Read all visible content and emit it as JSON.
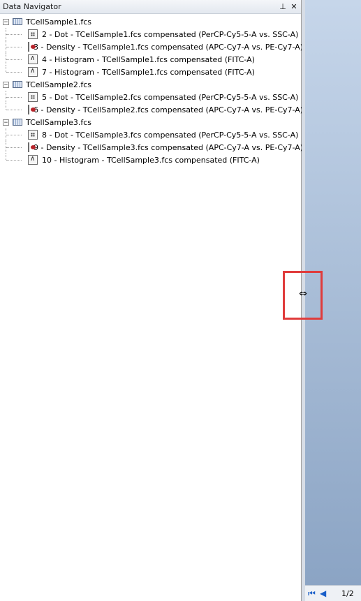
{
  "panel": {
    "title": "Data Navigator",
    "pin_glyph": "⊥",
    "close_glyph": "✕"
  },
  "tree": [
    {
      "file": "TCellSample1.fcs",
      "expander": "−",
      "children": [
        {
          "kind": "dot",
          "label": "2 - Dot - TCellSample1.fcs compensated (PerCP-Cy5-5-A vs. SSC-A)"
        },
        {
          "kind": "density",
          "label": "3 - Density - TCellSample1.fcs compensated (APC-Cy7-A vs. PE-Cy7-A)"
        },
        {
          "kind": "histogram",
          "label": "4 - Histogram - TCellSample1.fcs compensated (FITC-A)"
        },
        {
          "kind": "histogram",
          "label": "7 - Histogram - TCellSample1.fcs compensated (FITC-A)"
        }
      ]
    },
    {
      "file": "TCellSample2.fcs",
      "expander": "−",
      "children": [
        {
          "kind": "dot",
          "label": "5 - Dot - TCellSample2.fcs compensated (PerCP-Cy5-5-A vs. SSC-A)"
        },
        {
          "kind": "density",
          "label": "6 - Density - TCellSample2.fcs compensated (APC-Cy7-A vs. PE-Cy7-A)"
        }
      ]
    },
    {
      "file": "TCellSample3.fcs",
      "expander": "−",
      "children": [
        {
          "kind": "dot",
          "label": "8 - Dot - TCellSample3.fcs compensated (PerCP-Cy5-5-A vs. SSC-A)"
        },
        {
          "kind": "density",
          "label": "9 - Density - TCellSample3.fcs compensated (APC-Cy7-A vs. PE-Cy7-A)"
        },
        {
          "kind": "histogram",
          "label": "10 - Histogram - TCellSample3.fcs compensated (FITC-A)"
        }
      ]
    }
  ],
  "pager": {
    "first_glyph": "⏮",
    "prev_glyph": "◀",
    "page_indicator": "1/2"
  },
  "cursor": {
    "glyph": "⇔"
  },
  "colors": {
    "highlight": "#e03b3b",
    "pane_top": "#c6d6ea",
    "pane_bottom": "#8ba4c4"
  }
}
